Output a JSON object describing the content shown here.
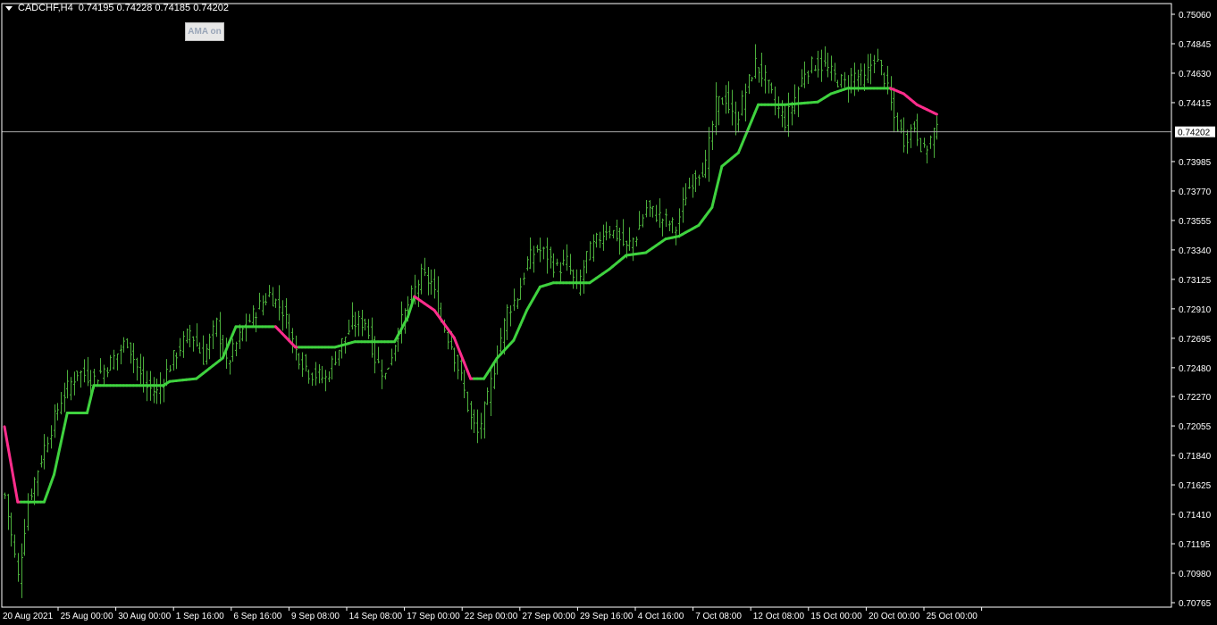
{
  "header": {
    "symbol_tf": "CADCHF,H4",
    "ohlc": "0.74195 0.74228 0.74185 0.74202",
    "menu_icon": "triangle-down-icon"
  },
  "ama_button": {
    "label": "AMA on"
  },
  "colors": {
    "background": "#000000",
    "bars": "#4caf3c",
    "ama_up": "#3fd23f",
    "ama_down": "#ff2d8c",
    "grid": "#ffffff",
    "bid_line": "#a9a9a9"
  },
  "chart_data": {
    "type": "line",
    "symbol": "CADCHF",
    "timeframe": "H4",
    "current_bid": "0.74202",
    "ylim": [
      0.70765,
      0.7506
    ],
    "y_ticks": [
      "0.75060",
      "0.74845",
      "0.74630",
      "0.74415",
      "0.74202",
      "0.73985",
      "0.73770",
      "0.73555",
      "0.73340",
      "0.73125",
      "0.72910",
      "0.72695",
      "0.72480",
      "0.72270",
      "0.72055",
      "0.71840",
      "0.71625",
      "0.71410",
      "0.71195",
      "0.70980",
      "0.70765"
    ],
    "x_ticks": [
      "20 Aug 2021",
      "25 Aug 00:00",
      "30 Aug 00:00",
      "1 Sep 16:00",
      "6 Sep 16:00",
      "9 Sep 08:00",
      "14 Sep 08:00",
      "17 Sep 00:00",
      "22 Sep 00:00",
      "27 Sep 00:00",
      "29 Sep 16:00",
      "4 Oct 16:00",
      "7 Oct 08:00",
      "12 Oct 08:00",
      "15 Oct 00:00",
      "20 Oct 00:00",
      "25 Oct 00:00"
    ],
    "price_anchors": [
      [
        0,
        0.7155
      ],
      [
        4,
        0.7095
      ],
      [
        7,
        0.715
      ],
      [
        12,
        0.719
      ],
      [
        17,
        0.7225
      ],
      [
        22,
        0.7245
      ],
      [
        27,
        0.724
      ],
      [
        32,
        0.7252
      ],
      [
        37,
        0.7268
      ],
      [
        42,
        0.7235
      ],
      [
        46,
        0.723
      ],
      [
        51,
        0.7255
      ],
      [
        56,
        0.7275
      ],
      [
        60,
        0.7255
      ],
      [
        64,
        0.728
      ],
      [
        67,
        0.725
      ],
      [
        72,
        0.7275
      ],
      [
        76,
        0.729
      ],
      [
        80,
        0.7302
      ],
      [
        84,
        0.729
      ],
      [
        88,
        0.726
      ],
      [
        92,
        0.7245
      ],
      [
        97,
        0.724
      ],
      [
        101,
        0.7262
      ],
      [
        105,
        0.728
      ],
      [
        109,
        0.7282
      ],
      [
        112,
        0.7255
      ],
      [
        115,
        0.7242
      ],
      [
        119,
        0.7275
      ],
      [
        123,
        0.73
      ],
      [
        126,
        0.7315
      ],
      [
        129,
        0.731
      ],
      [
        132,
        0.7283
      ],
      [
        135,
        0.7265
      ],
      [
        138,
        0.724
      ],
      [
        141,
        0.721
      ],
      [
        143,
        0.72
      ],
      [
        146,
        0.7225
      ],
      [
        149,
        0.726
      ],
      [
        152,
        0.729
      ],
      [
        155,
        0.73
      ],
      [
        158,
        0.7325
      ],
      [
        161,
        0.7335
      ],
      [
        164,
        0.733
      ],
      [
        167,
        0.732
      ],
      [
        170,
        0.7325
      ],
      [
        173,
        0.7305
      ],
      [
        176,
        0.733
      ],
      [
        179,
        0.734
      ],
      [
        182,
        0.735
      ],
      [
        185,
        0.7345
      ],
      [
        188,
        0.7335
      ],
      [
        191,
        0.7345
      ],
      [
        194,
        0.7365
      ],
      [
        197,
        0.736
      ],
      [
        200,
        0.7355
      ],
      [
        203,
        0.735
      ],
      [
        206,
        0.7375
      ],
      [
        209,
        0.739
      ],
      [
        212,
        0.7395
      ],
      [
        215,
        0.744
      ],
      [
        218,
        0.7445
      ],
      [
        221,
        0.7425
      ],
      [
        224,
        0.745
      ],
      [
        227,
        0.747
      ],
      [
        230,
        0.7458
      ],
      [
        233,
        0.744
      ],
      [
        236,
        0.7428
      ],
      [
        239,
        0.7445
      ],
      [
        242,
        0.7465
      ],
      [
        245,
        0.747
      ],
      [
        248,
        0.7468
      ],
      [
        251,
        0.746
      ],
      [
        254,
        0.7455
      ],
      [
        257,
        0.7462
      ],
      [
        260,
        0.7458
      ],
      [
        263,
        0.7475
      ],
      [
        266,
        0.746
      ],
      [
        269,
        0.743
      ],
      [
        272,
        0.7415
      ],
      [
        275,
        0.7425
      ],
      [
        278,
        0.7405
      ],
      [
        281,
        0.742
      ],
      [
        282,
        0.742
      ]
    ],
    "series": [
      {
        "name": "AMA",
        "anchors": [
          [
            0,
            0.7205
          ],
          [
            4,
            0.715
          ],
          [
            12,
            0.715
          ],
          [
            15,
            0.717
          ],
          [
            19,
            0.7215
          ],
          [
            25,
            0.7215
          ],
          [
            27,
            0.7235
          ],
          [
            48,
            0.7235
          ],
          [
            50,
            0.7238
          ],
          [
            58,
            0.724
          ],
          [
            66,
            0.7255
          ],
          [
            70,
            0.7278
          ],
          [
            82,
            0.7278
          ],
          [
            88,
            0.7263
          ],
          [
            100,
            0.7263
          ],
          [
            106,
            0.7267
          ],
          [
            118,
            0.7267
          ],
          [
            122,
            0.7285
          ],
          [
            124,
            0.73
          ],
          [
            130,
            0.729
          ],
          [
            136,
            0.727
          ],
          [
            141,
            0.724
          ],
          [
            145,
            0.724
          ],
          [
            149,
            0.7255
          ],
          [
            154,
            0.7268
          ],
          [
            158,
            0.729
          ],
          [
            162,
            0.7307
          ],
          [
            166,
            0.731
          ],
          [
            177,
            0.731
          ],
          [
            183,
            0.732
          ],
          [
            188,
            0.733
          ],
          [
            194,
            0.7332
          ],
          [
            200,
            0.7342
          ],
          [
            204,
            0.7344
          ],
          [
            210,
            0.7352
          ],
          [
            214,
            0.7365
          ],
          [
            217,
            0.7395
          ],
          [
            222,
            0.7405
          ],
          [
            228,
            0.744
          ],
          [
            236,
            0.744
          ],
          [
            246,
            0.7442
          ],
          [
            250,
            0.7448
          ],
          [
            255,
            0.7452
          ],
          [
            268,
            0.7452
          ],
          [
            272,
            0.7448
          ],
          [
            276,
            0.744
          ],
          [
            282,
            0.7433
          ]
        ]
      }
    ],
    "grid": false,
    "legend": "none"
  }
}
